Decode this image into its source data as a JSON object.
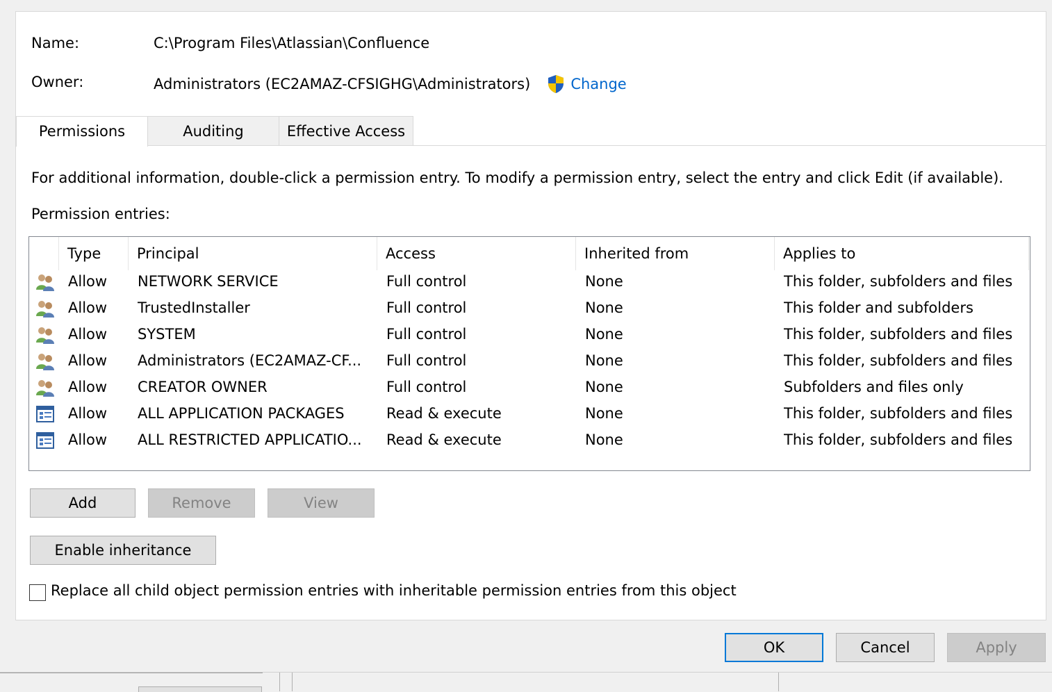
{
  "header": {
    "name_label": "Name:",
    "name_value": "C:\\Program Files\\Atlassian\\Confluence",
    "owner_label": "Owner:",
    "owner_value": "Administrators (EC2AMAZ-CFSIGHG\\Administrators)",
    "change_link": "Change"
  },
  "tabs": [
    {
      "label": "Permissions",
      "active": true
    },
    {
      "label": "Auditing",
      "active": false
    },
    {
      "label": "Effective Access",
      "active": false
    }
  ],
  "info_text": "For additional information, double-click a permission entry. To modify a permission entry, select the entry and click Edit (if available).",
  "entries_label": "Permission entries:",
  "columns": [
    "Type",
    "Principal",
    "Access",
    "Inherited from",
    "Applies to"
  ],
  "entries": [
    {
      "icon": "users-icon",
      "type": "Allow",
      "principal": "NETWORK SERVICE",
      "access": "Full control",
      "inherited": "None",
      "applies": "This folder, subfolders and files"
    },
    {
      "icon": "users-icon",
      "type": "Allow",
      "principal": "TrustedInstaller",
      "access": "Full control",
      "inherited": "None",
      "applies": "This folder and subfolders"
    },
    {
      "icon": "users-icon",
      "type": "Allow",
      "principal": "SYSTEM",
      "access": "Full control",
      "inherited": "None",
      "applies": "This folder, subfolders and files"
    },
    {
      "icon": "users-icon",
      "type": "Allow",
      "principal": "Administrators (EC2AMAZ-CF...",
      "access": "Full control",
      "inherited": "None",
      "applies": "This folder, subfolders and files"
    },
    {
      "icon": "users-icon",
      "type": "Allow",
      "principal": "CREATOR OWNER",
      "access": "Full control",
      "inherited": "None",
      "applies": "Subfolders and files only"
    },
    {
      "icon": "app-package-icon",
      "type": "Allow",
      "principal": "ALL APPLICATION PACKAGES",
      "access": "Read & execute",
      "inherited": "None",
      "applies": "This folder, subfolders and files"
    },
    {
      "icon": "app-package-icon",
      "type": "Allow",
      "principal": "ALL RESTRICTED APPLICATIO...",
      "access": "Read & execute",
      "inherited": "None",
      "applies": "This folder, subfolders and files"
    }
  ],
  "buttons": {
    "add": "Add",
    "remove": "Remove",
    "view": "View",
    "enable_inheritance": "Enable inheritance"
  },
  "replace_checkbox": {
    "label": "Replace all child object permission entries with inheritable permission entries from this object",
    "checked": false
  },
  "dialog_buttons": {
    "ok": "OK",
    "cancel": "Cancel",
    "apply": "Apply"
  },
  "colors": {
    "link": "#0066cc",
    "default_button_border": "#0078d7",
    "disabled_text": "#838383"
  }
}
